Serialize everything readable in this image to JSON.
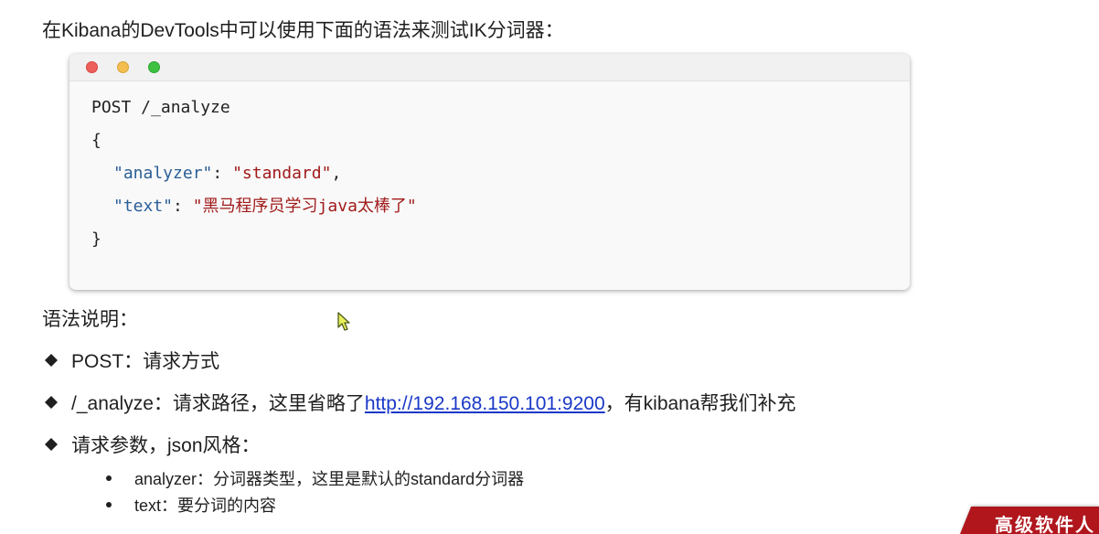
{
  "intro_text": "在Kibana的DevTools中可以使用下面的语法来测试IK分词器：",
  "code_window": {
    "buttons": [
      {
        "name": "close",
        "color": "#ec5f5b"
      },
      {
        "name": "minimize",
        "color": "#f3be4f"
      },
      {
        "name": "maximize",
        "color": "#3ec043"
      }
    ],
    "lines": {
      "request": "POST /_analyze",
      "open_brace": "{",
      "analyzer_key": "\"analyzer\"",
      "analyzer_sep": ": ",
      "analyzer_value": "\"standard\"",
      "analyzer_comma": ",",
      "text_key": "\"text\"",
      "text_sep": ": ",
      "text_value": "\"黑马程序员学习java太棒了\"",
      "close_brace": "}"
    },
    "colors": {
      "key": "#2a5e97",
      "string": "#a11a1a"
    }
  },
  "section_title": "语法说明：",
  "bullets": [
    {
      "text": "POST：请求方式"
    },
    {
      "prefix": "/_analyze：请求路径，这里省略了",
      "link": "http://192.168.150.101:9200",
      "suffix": "，有kibana帮我们补充"
    },
    {
      "text": "请求参数，json风格："
    }
  ],
  "sub_bullets": [
    "analyzer：分词器类型，这里是默认的standard分词器",
    "text：要分词的内容"
  ],
  "watermark_text": "高级软件人",
  "colors": {
    "link": "#1a38c7",
    "watermark_bg": "#b0161c"
  }
}
